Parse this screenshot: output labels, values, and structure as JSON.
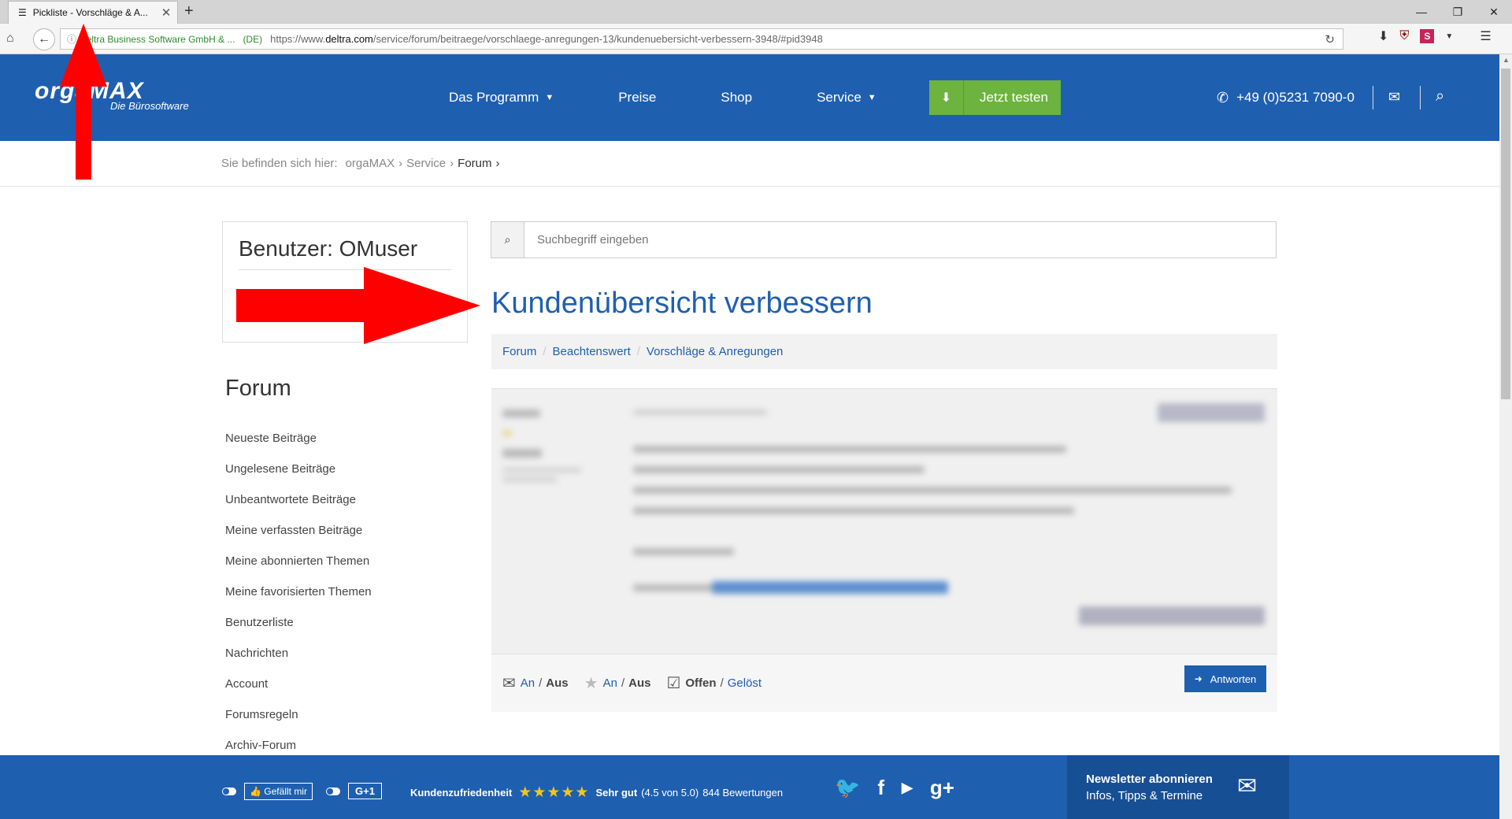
{
  "browser": {
    "tab_title": "Pickliste - Vorschläge & A...",
    "url_company": "deltra Business Software GmbH & ...",
    "url_country": "(DE)",
    "url_prefix": "https://www.",
    "url_domain": "deltra.com",
    "url_path": "/service/forum/beitraege/vorschlaege-anregungen-13/kundenuebersicht-verbessern-3948/#pid3948"
  },
  "header": {
    "logo_text": "orgaMAX",
    "logo_sub": "Die Bürosoftware",
    "nav": [
      "Das Programm",
      "Preise",
      "Shop",
      "Service"
    ],
    "cta": "Jetzt testen",
    "phone": "+49 (0)5231 7090-0"
  },
  "breadcrumb": {
    "prefix": "Sie befinden sich hier:",
    "items": [
      "orgaMAX",
      "Service",
      "Forum"
    ]
  },
  "sidebar": {
    "user_label": "Benutzer: OMuser",
    "title": "Forum",
    "items": [
      "Neueste Beiträge",
      "Ungelesene Beiträge",
      "Unbeantwortete Beiträge",
      "Meine verfassten Beiträge",
      "Meine abonnierten Themen",
      "Meine favorisierten Themen",
      "Benutzerliste",
      "Nachrichten",
      "Account",
      "Forumsregeln",
      "Archiv-Forum"
    ]
  },
  "search": {
    "placeholder": "Suchbegriff eingeben"
  },
  "main": {
    "title": "Kundenübersicht verbessern",
    "crumbs": [
      "Forum",
      "Beachtenswert",
      "Vorschläge & Anregungen"
    ],
    "actions": {
      "an": "An",
      "aus": "Aus",
      "offen": "Offen",
      "geloest": "Gelöst",
      "reply": "Antworten"
    }
  },
  "footer": {
    "like": "Gefällt mir",
    "gplus": "G+1",
    "rating_label": "Kundenzufriedenheit",
    "rating_stars": "★★★★★",
    "rating_text": "Sehr gut",
    "rating_value": "(4.5 von 5.0)",
    "rating_count": "844 Bewertungen",
    "newsletter_title": "Newsletter abonnieren",
    "newsletter_sub": "Infos, Tipps & Termine"
  },
  "colors": {
    "brand_blue": "#1f5fb0",
    "cta_green": "#6db33f",
    "annotation_red": "#ff0000"
  }
}
